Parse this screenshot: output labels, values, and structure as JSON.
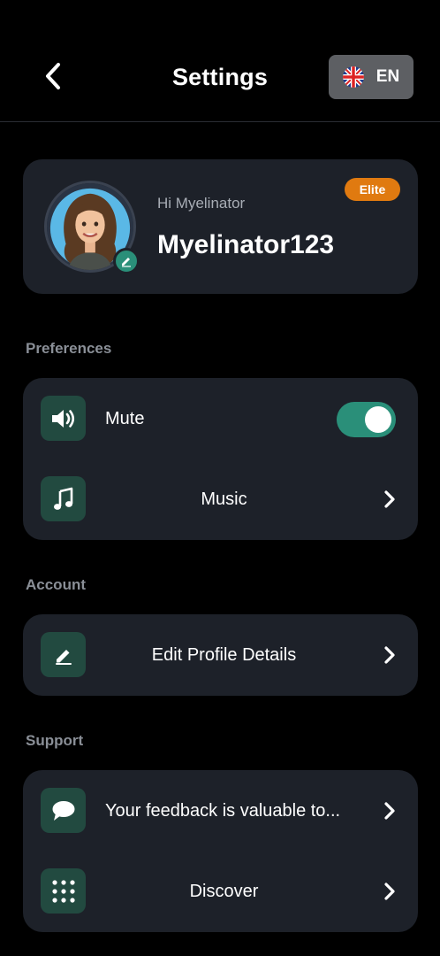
{
  "header": {
    "title": "Settings",
    "language": {
      "code": "EN",
      "flag_icon": "uk-flag-icon"
    }
  },
  "profile": {
    "greeting": "Hi Myelinator",
    "username": "Myelinator123",
    "badge": "Elite"
  },
  "sections": {
    "preferences": {
      "label": "Preferences",
      "items": [
        {
          "label": "Mute",
          "icon": "speaker-icon",
          "toggle_on": true
        },
        {
          "label": "Music",
          "icon": "music-note-icon"
        }
      ]
    },
    "account": {
      "label": "Account",
      "items": [
        {
          "label": "Edit Profile Details",
          "icon": "pencil-icon"
        }
      ]
    },
    "support": {
      "label": "Support",
      "items": [
        {
          "label": "Your feedback is valuable to...",
          "icon": "chat-bubble-icon"
        },
        {
          "label": "Discover",
          "icon": "grid-dots-icon"
        }
      ]
    }
  },
  "colors": {
    "background": "#000000",
    "card": "#1d2129",
    "accent": "#2a8f79",
    "icon_tile": "#224a40",
    "badge": "#e07a10"
  }
}
